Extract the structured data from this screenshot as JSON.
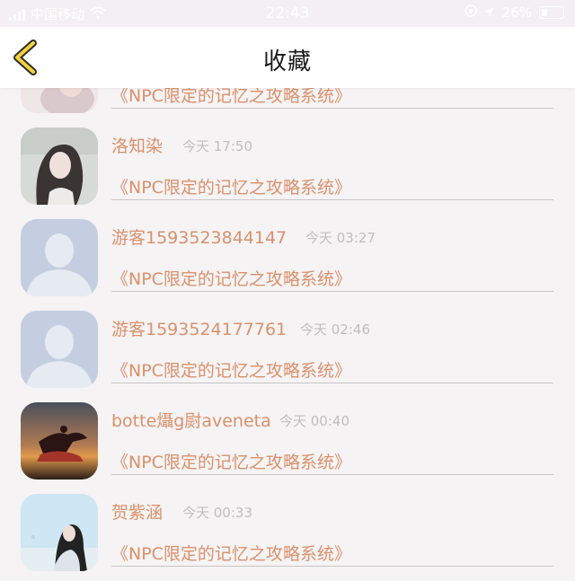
{
  "status_bar": {
    "carrier": "中国移动",
    "time": "22:43",
    "battery": "26%"
  },
  "header": {
    "title": "收藏"
  },
  "favorites": [
    {
      "name": "",
      "time": "",
      "novel": "《NPC限定的记忆之攻略系统》",
      "avatar": "photo-girl-light"
    },
    {
      "name": "洛知染",
      "time": "今天 17:50",
      "novel": "《NPC限定的记忆之攻略系统》",
      "avatar": "photo-girl-long-hair"
    },
    {
      "name": "游客1593523844147",
      "time": "今天 03:27",
      "novel": "《NPC限定的记忆之攻略系统》",
      "avatar": "default-user-silhouette"
    },
    {
      "name": "游客1593524177761",
      "time": "今天 02:46",
      "novel": "《NPC限定的记忆之攻略系统》",
      "avatar": "default-user-silhouette"
    },
    {
      "name": "botte㸎g㷉aveneta",
      "time": "今天 00:40",
      "novel": "《NPC限定的记忆之攻略系统》",
      "avatar": "photo-dancer-sunset"
    },
    {
      "name": "贺紫涵",
      "time": "今天 00:33",
      "novel": "《NPC限定的记忆之攻略系统》",
      "avatar": "photo-girl-sky"
    }
  ],
  "colors": {
    "accent_text": "#d9916a",
    "back_arrow": "#f2d23c",
    "meta_text": "#c2bcbe",
    "page_bg": "#f6f3f5"
  }
}
